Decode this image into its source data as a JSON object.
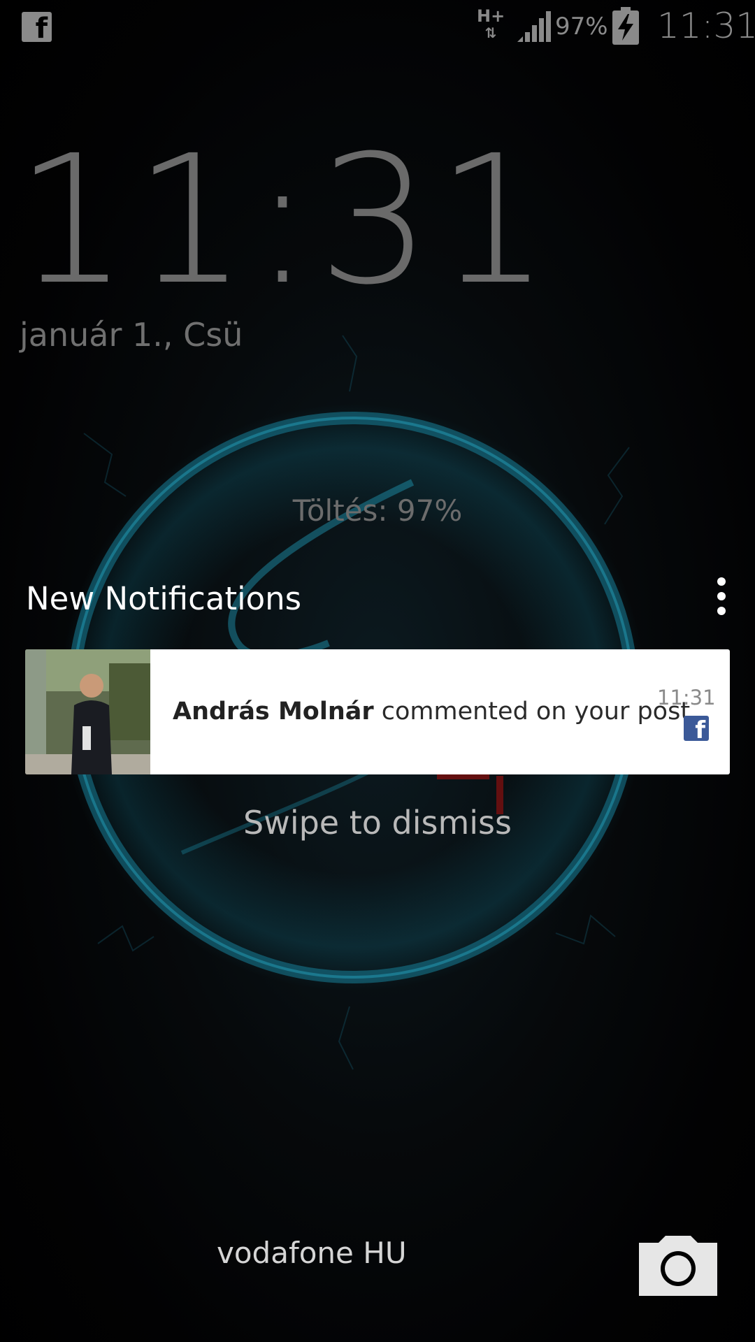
{
  "status_bar": {
    "notification_icon": "facebook-icon",
    "network_type": "H+",
    "network_arrows": "⇅",
    "signal_icon": "signal-bars-icon",
    "battery_percent": "97%",
    "battery_icon": "battery-charging-icon",
    "time": "11:31"
  },
  "lockscreen": {
    "clock": "11:31",
    "date": "január 1., Csü",
    "charging_status": "Töltés: 97%"
  },
  "notifications": {
    "header": "New Notifications",
    "menu_icon": "overflow-menu-icon",
    "items": [
      {
        "author": "András Molnár",
        "action": " commented on your post.",
        "time": "11:31",
        "app_icon": "facebook-icon",
        "avatar": "profile-photo"
      }
    ],
    "swipe_hint": "Swipe to dismiss"
  },
  "footer": {
    "carrier": "vodafone HU",
    "camera_icon": "camera-icon"
  },
  "colors": {
    "accent_glow": "#1aa3c4",
    "facebook_blue": "#3b5998",
    "card_background": "#ffffff"
  }
}
